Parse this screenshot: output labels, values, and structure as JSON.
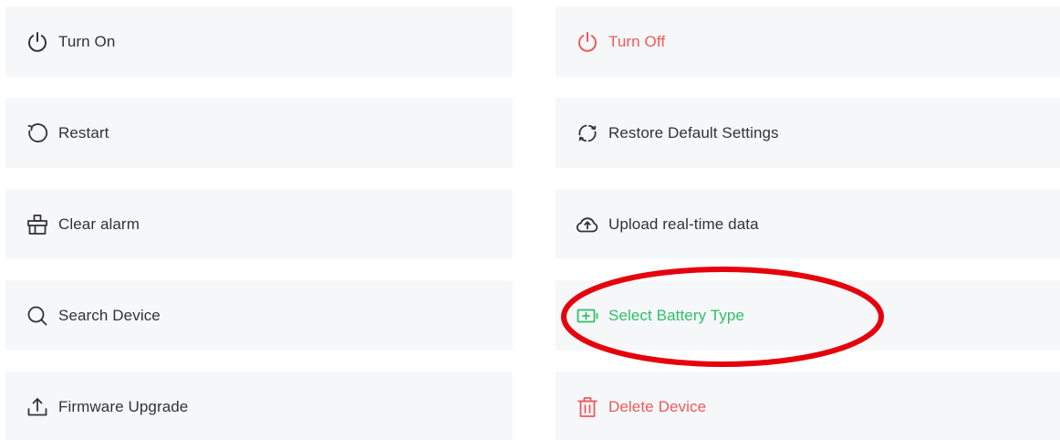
{
  "colors": {
    "default_text": "#333333",
    "danger": "#f0595b",
    "success": "#2fbf6a",
    "card_background": "#f6f7f9",
    "annotation": "#e5000c"
  },
  "actions": [
    {
      "label": "Turn On",
      "icon": "power-icon",
      "tone": "default"
    },
    {
      "label": "Turn Off",
      "icon": "power-icon",
      "tone": "danger"
    },
    {
      "label": "Restart",
      "icon": "restart-icon",
      "tone": "default"
    },
    {
      "label": "Restore Default Settings",
      "icon": "refresh-icon",
      "tone": "default"
    },
    {
      "label": "Clear alarm",
      "icon": "clear-alarm-icon",
      "tone": "default"
    },
    {
      "label": "Upload real-time data",
      "icon": "cloud-upload-icon",
      "tone": "default"
    },
    {
      "label": "Search Device",
      "icon": "search-icon",
      "tone": "default"
    },
    {
      "label": "Select Battery Type",
      "icon": "battery-add-icon",
      "tone": "success"
    },
    {
      "label": "Firmware Upgrade",
      "icon": "upload-icon",
      "tone": "default"
    },
    {
      "label": "Delete Device",
      "icon": "trash-icon",
      "tone": "danger"
    }
  ]
}
